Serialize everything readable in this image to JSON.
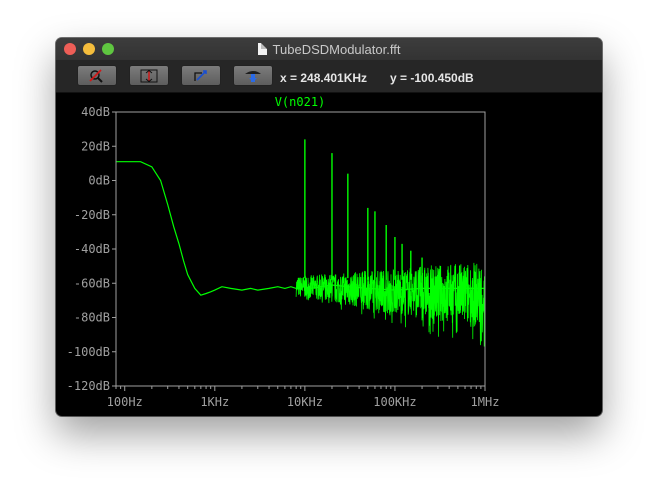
{
  "window": {
    "title": "TubeDSDModulator.fft"
  },
  "toolbar": {
    "buttons": [
      {
        "name": "zoom-out-icon"
      },
      {
        "name": "zoom-fit-icon"
      },
      {
        "name": "pan-icon"
      },
      {
        "name": "autoscale-icon"
      }
    ],
    "x_readout": "x = 248.401KHz",
    "y_readout": "y = -100.450dB"
  },
  "colors": {
    "trace": "#00ff00",
    "axis": "#a0a0a0",
    "background": "#000000"
  },
  "chart_data": {
    "type": "line",
    "title": "V(n021)",
    "xlabel": "",
    "ylabel": "",
    "x_scale": "log",
    "xlim": [
      80,
      1000000
    ],
    "ylim": [
      -120,
      40
    ],
    "grid": false,
    "x_tick_labels": [
      "100Hz",
      "1KHz",
      "10KHz",
      "100KHz",
      "1MHz"
    ],
    "x_tick_values": [
      100,
      1000,
      10000,
      100000,
      1000000
    ],
    "y_tick_labels": [
      "40dB",
      "20dB",
      "0dB",
      "-20dB",
      "-40dB",
      "-60dB",
      "-80dB",
      "-100dB",
      "-120dB"
    ],
    "y_tick_values": [
      40,
      20,
      0,
      -20,
      -40,
      -60,
      -80,
      -100,
      -120
    ],
    "series": [
      {
        "color": "#00ff00",
        "x": [
          80,
          150,
          200,
          250,
          300,
          350,
          400,
          450,
          500,
          600,
          700,
          800,
          900,
          1000,
          1200,
          1500,
          2000,
          2500,
          3000,
          4000,
          5000,
          6000,
          7000,
          8000,
          10000,
          12000,
          15000,
          20000,
          30000,
          50000,
          100000,
          200000,
          500000,
          1000000
        ],
        "y": [
          11,
          11,
          8,
          0,
          -14,
          -27,
          -37,
          -47,
          -55,
          -63,
          -67,
          -66,
          -65,
          -64,
          -62,
          -63,
          -64,
          -63,
          -64,
          -63,
          -62,
          -63,
          -62,
          -63,
          -62,
          -63,
          -62,
          -61,
          -62,
          -63,
          -64,
          -63,
          -63,
          -63
        ]
      }
    ],
    "spurs": [
      {
        "x": 10000,
        "top": 24,
        "bottom": -57
      },
      {
        "x": 20000,
        "top": 16,
        "bottom": -58
      },
      {
        "x": 30000,
        "top": 4,
        "bottom": -57
      },
      {
        "x": 50000,
        "top": -16,
        "bottom": -58
      },
      {
        "x": 60000,
        "top": -18,
        "bottom": -58
      },
      {
        "x": 80000,
        "top": -26,
        "bottom": -58
      },
      {
        "x": 100000,
        "top": -33,
        "bottom": -58
      },
      {
        "x": 120000,
        "top": -37,
        "bottom": -58
      },
      {
        "x": 150000,
        "top": -41,
        "bottom": -58
      },
      {
        "x": 200000,
        "top": -45,
        "bottom": -59
      }
    ],
    "noise_floor": {
      "x_start": 8000,
      "x_end": 1000000,
      "mean_start": -62,
      "mean_end": -67,
      "spread_start": 6,
      "spread_end": 20
    }
  }
}
